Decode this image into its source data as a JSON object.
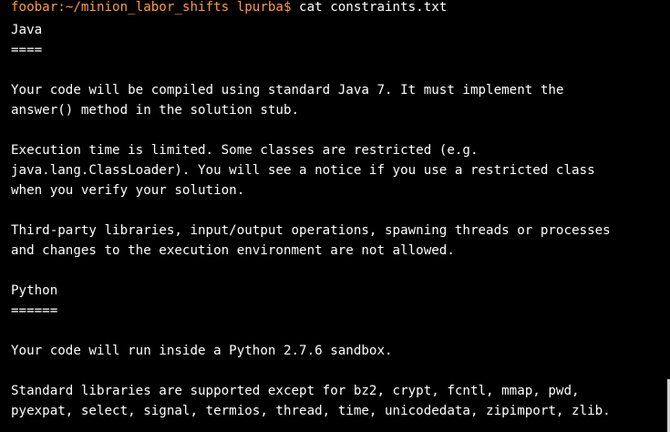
{
  "terminal": {
    "prompt": "foobar:~/minion_labor_shifts lpurba$",
    "command": " cat constraints.txt",
    "lines": [
      "Java",
      "====",
      "",
      "Your code will be compiled using standard Java 7. It must implement the",
      "answer() method in the solution stub.",
      "",
      "Execution time is limited. Some classes are restricted (e.g.",
      "java.lang.ClassLoader). You will see a notice if you use a restricted class",
      "when you verify your solution.",
      "",
      "Third-party libraries, input/output operations, spawning threads or processes",
      "and changes to the execution environment are not allowed.",
      "",
      "Python",
      "======",
      "",
      "Your code will run inside a Python 2.7.6 sandbox.",
      "",
      "Standard libraries are supported except for bz2, crypt, fcntl, mmap, pwd,",
      "pyexpat, select, signal, termios, thread, time, unicodedata, zipimport, zlib."
    ]
  },
  "colors": {
    "background": "#000000",
    "text": "#ffffff",
    "prompt": "#ff9c3b"
  }
}
